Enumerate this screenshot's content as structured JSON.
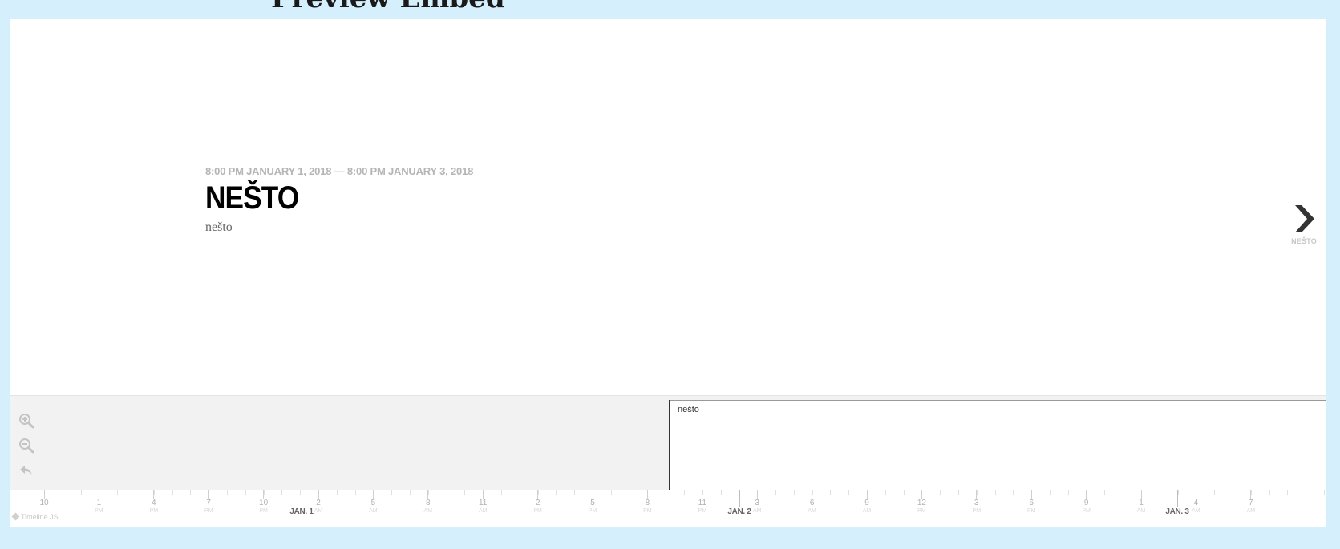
{
  "page": {
    "heading": "Preview Embed"
  },
  "slide": {
    "date": "8:00 PM JANUARY 1, 2018 — 8:00 PM JANUARY 3, 2018",
    "headline": "NEŠTO",
    "body": "nešto"
  },
  "nav_next": {
    "icon": "chevron-right-icon",
    "title": "NEŠTO"
  },
  "zoom_controls": [
    {
      "name": "zoom-in-button",
      "icon": "zoom-in-icon"
    },
    {
      "name": "zoom-out-button",
      "icon": "zoom-out-icon"
    },
    {
      "name": "back-to-start-button",
      "icon": "undo-arrow-icon"
    }
  ],
  "marker": {
    "title": "nešto"
  },
  "timeaxis": {
    "ticks": [
      {
        "num": "10",
        "mer": ""
      },
      {
        "num": "1",
        "mer": "PM"
      },
      {
        "num": "4",
        "mer": "PM"
      },
      {
        "num": "7",
        "mer": "PM"
      },
      {
        "num": "10",
        "mer": "PM"
      },
      {
        "num": "2",
        "mer": "AM"
      },
      {
        "num": "5",
        "mer": "AM"
      },
      {
        "num": "8",
        "mer": "AM"
      },
      {
        "num": "11",
        "mer": "AM"
      },
      {
        "num": "2",
        "mer": "PM"
      },
      {
        "num": "5",
        "mer": "PM"
      },
      {
        "num": "8",
        "mer": "PM"
      },
      {
        "num": "11",
        "mer": "PM"
      },
      {
        "num": "3",
        "mer": "AM"
      },
      {
        "num": "6",
        "mer": "AM"
      },
      {
        "num": "9",
        "mer": "AM"
      },
      {
        "num": "12",
        "mer": "PM"
      },
      {
        "num": "3",
        "mer": "PM"
      },
      {
        "num": "6",
        "mer": "PM"
      },
      {
        "num": "9",
        "mer": "PM"
      },
      {
        "num": "1",
        "mer": "AM"
      },
      {
        "num": "4",
        "mer": "AM"
      },
      {
        "num": "7",
        "mer": "AM"
      }
    ],
    "major_labels": [
      "JAN. 1",
      "JAN. 2",
      "JAN. 3"
    ]
  },
  "attribution": {
    "text": "Timeline JS"
  },
  "colors": {
    "page_background": "#d6effc",
    "timenav_background": "#f2f2f2",
    "headline": "#000000",
    "date": "#b5b5b5"
  }
}
